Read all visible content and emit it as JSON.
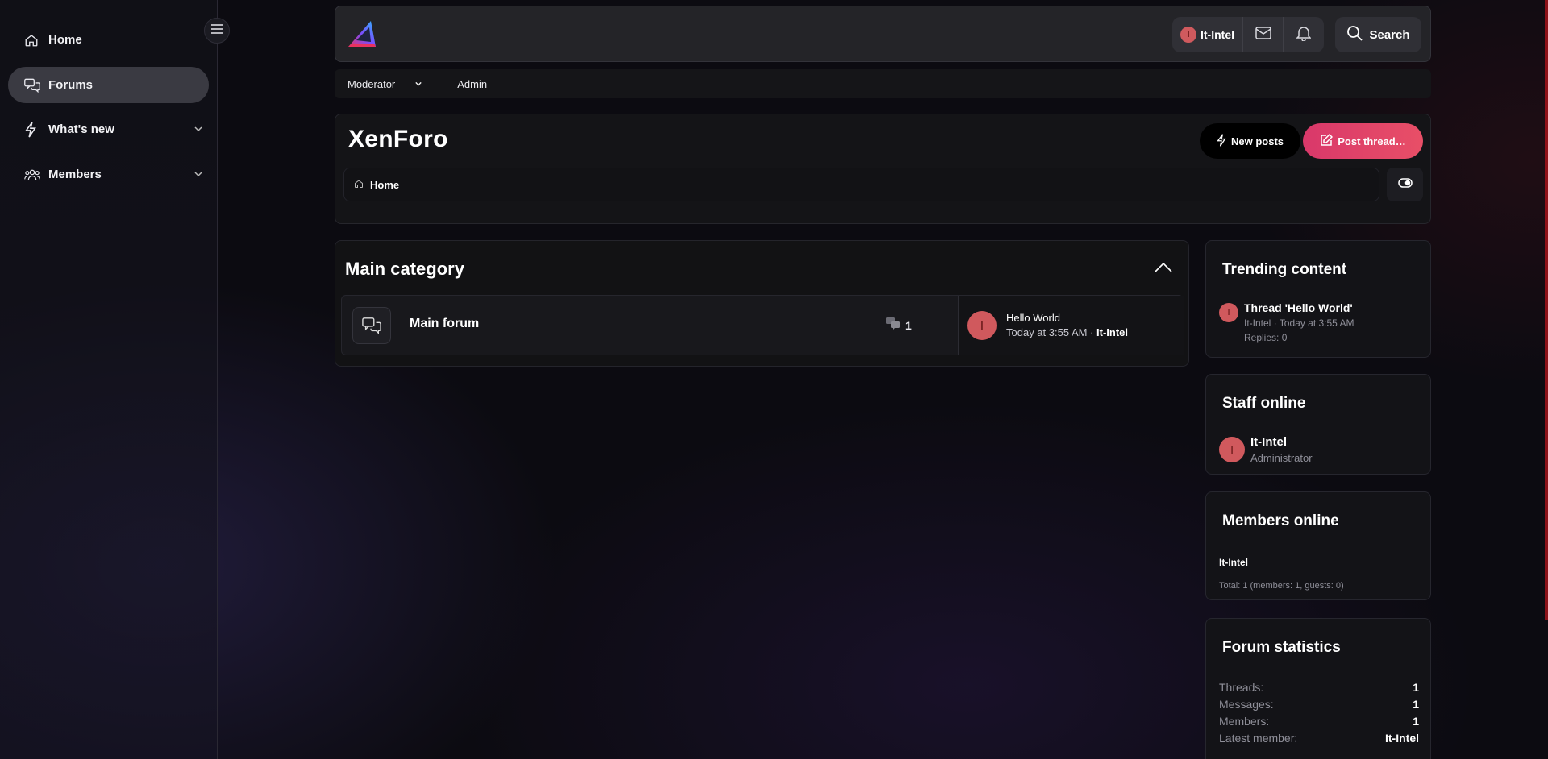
{
  "sidebar": {
    "items": [
      {
        "label": "Home",
        "icon": "home-icon"
      },
      {
        "label": "Forums",
        "icon": "chat-icon",
        "active": true
      },
      {
        "label": "What's new",
        "icon": "bolt-icon",
        "expandable": true
      },
      {
        "label": "Members",
        "icon": "users-icon",
        "expandable": true
      }
    ]
  },
  "topbar": {
    "user": "It-Intel",
    "avatar_letter": "I",
    "search_label": "Search"
  },
  "subnav": {
    "moderator": "Moderator",
    "admin": "Admin"
  },
  "header": {
    "title": "XenForo",
    "new_posts": "New posts",
    "post_thread": "Post thread…",
    "breadcrumb": "Home"
  },
  "category": {
    "title": "Main category",
    "forum": {
      "name": "Main forum",
      "count": "1",
      "last_title": "Hello World",
      "last_time": "Today at 3:55 AM",
      "last_user": "It-Intel",
      "avatar_letter": "I"
    }
  },
  "widgets": {
    "trending": {
      "title": "Trending content",
      "item_title": "Thread 'Hello World'",
      "item_meta": "It-Intel · Today at 3:55 AM",
      "item_replies": "Replies: 0",
      "avatar_letter": "I"
    },
    "staff": {
      "title": "Staff online",
      "name": "It-Intel",
      "role": "Administrator",
      "avatar_letter": "I"
    },
    "members": {
      "title": "Members online",
      "name": "It-Intel",
      "total": "Total: 1 (members: 1, guests: 0)"
    },
    "stats": {
      "title": "Forum statistics",
      "rows": [
        {
          "k": "Threads:",
          "v": "1"
        },
        {
          "k": "Messages:",
          "v": "1"
        },
        {
          "k": "Members:",
          "v": "1"
        },
        {
          "k": "Latest member:",
          "v": "It-Intel"
        }
      ]
    }
  },
  "colors": {
    "accent": "#e23f68",
    "avatar": "#d0595d",
    "surface": "#131317"
  }
}
